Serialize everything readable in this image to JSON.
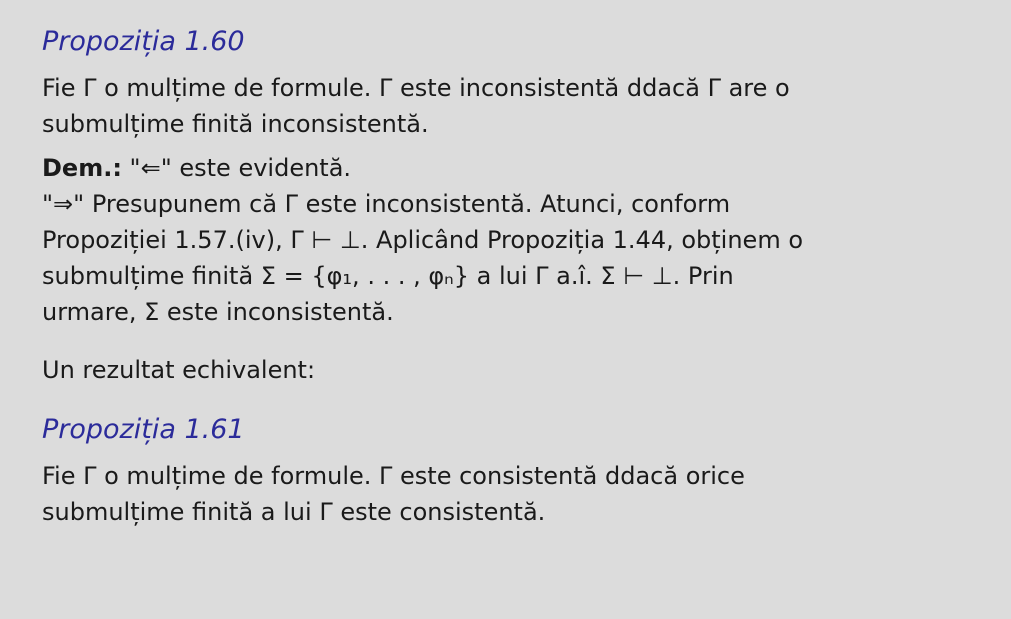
{
  "proposition_1": {
    "title": "Propoziția 1.60",
    "statement_line1": "Fie Γ o mulțime de formule. Γ este inconsistentă  ddacă Γ are o",
    "statement_line2": "submulțime finită inconsistentă."
  },
  "proof": {
    "label": "Dem.:",
    "line1_rest": " \"⇐\" este evidentă.",
    "line2": "\"⇒\" Presupunem că Γ este inconsistentă. Atunci, conform",
    "line3": "Propoziției 1.57.(iv), Γ ⊢ ⊥. Aplicând Propoziția 1.44, obținem o",
    "line4": "submulțime finită Σ = {φ₁, . . . , φₙ} a lui Γ  a.î.  Σ ⊢ ⊥. Prin",
    "line5": "urmare, Σ este inconsistentă."
  },
  "intro": {
    "text": "Un rezultat echivalent:"
  },
  "proposition_2": {
    "title": "Propoziția 1.61",
    "statement_line1": "Fie Γ o mulțime de formule. Γ este consistentă  ddacă orice",
    "statement_line2": "submulțime finită a lui Γ este consistentă."
  }
}
